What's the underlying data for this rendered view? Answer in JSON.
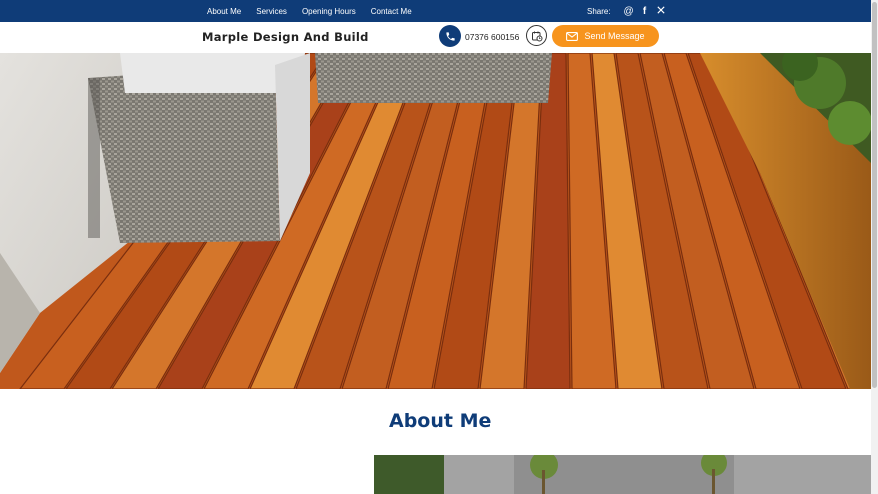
{
  "topbar": {
    "nav": [
      "About Me",
      "Services",
      "Opening Hours",
      "Contact Me"
    ],
    "share_label": "Share:",
    "share_icons": [
      "email-icon",
      "facebook-icon",
      "x-icon"
    ],
    "share_glyphs": [
      "@",
      "f",
      "𝕏"
    ]
  },
  "header": {
    "brand": "Marple Design And Build",
    "phone": "07376 600156",
    "send_label": "Send Message"
  },
  "hero": {
    "image": "wooden decking with wicker garden armchairs"
  },
  "about": {
    "title": "About Me"
  },
  "colors": {
    "navy": "#0f3c78",
    "accent_orange": "#f7941d"
  }
}
